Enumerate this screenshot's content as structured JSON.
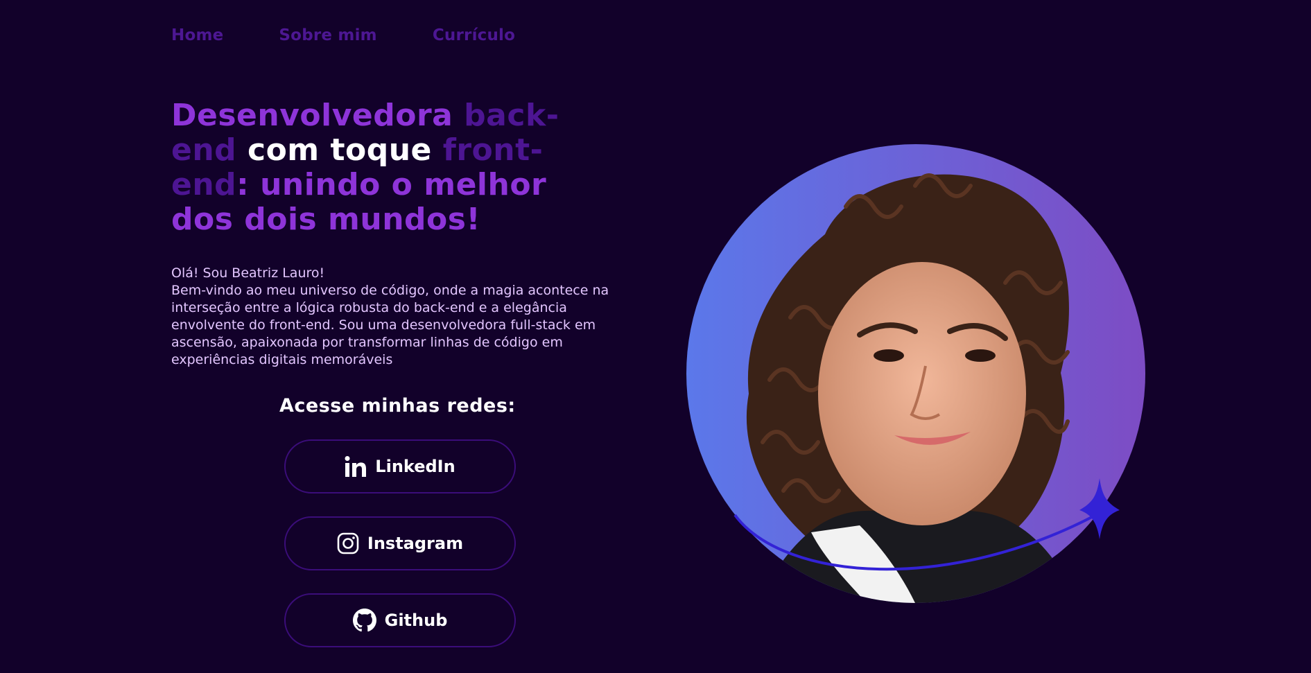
{
  "nav": {
    "home": "Home",
    "about": "Sobre mim",
    "resume": "Currículo"
  },
  "hero": {
    "title_part1": "Desenvolvedora ",
    "title_part2": "back-end",
    "title_part3": " com toque ",
    "title_part4": "front-end",
    "title_part5": ": unindo o melhor dos dois mundos!",
    "greeting": "Olá! Sou Beatriz Lauro!",
    "description": "Bem-vindo ao meu universo de código, onde a magia acontece na interseção entre a lógica robusta do back-end e a elegância envolvente do front-end. Sou uma desenvolvedora full-stack em ascensão, apaixonada por transformar linhas de código em experiências digitais memoráveis"
  },
  "social": {
    "title": "Acesse minhas redes:",
    "linkedin": "LinkedIn",
    "instagram": "Instagram",
    "github": "Github"
  },
  "icons": {
    "linkedin": "linkedin-icon",
    "instagram": "instagram-icon",
    "github": "github-icon",
    "sparkle": "sparkle-icon"
  },
  "colors": {
    "background": "#12012a",
    "accent": "#8e34d9",
    "accent_dim": "#4d1593",
    "button_border": "#3b0d7a",
    "portrait_bg_start": "#5b73e8",
    "portrait_bg_end": "#7b4ec8",
    "sparkle": "#3322d6"
  }
}
